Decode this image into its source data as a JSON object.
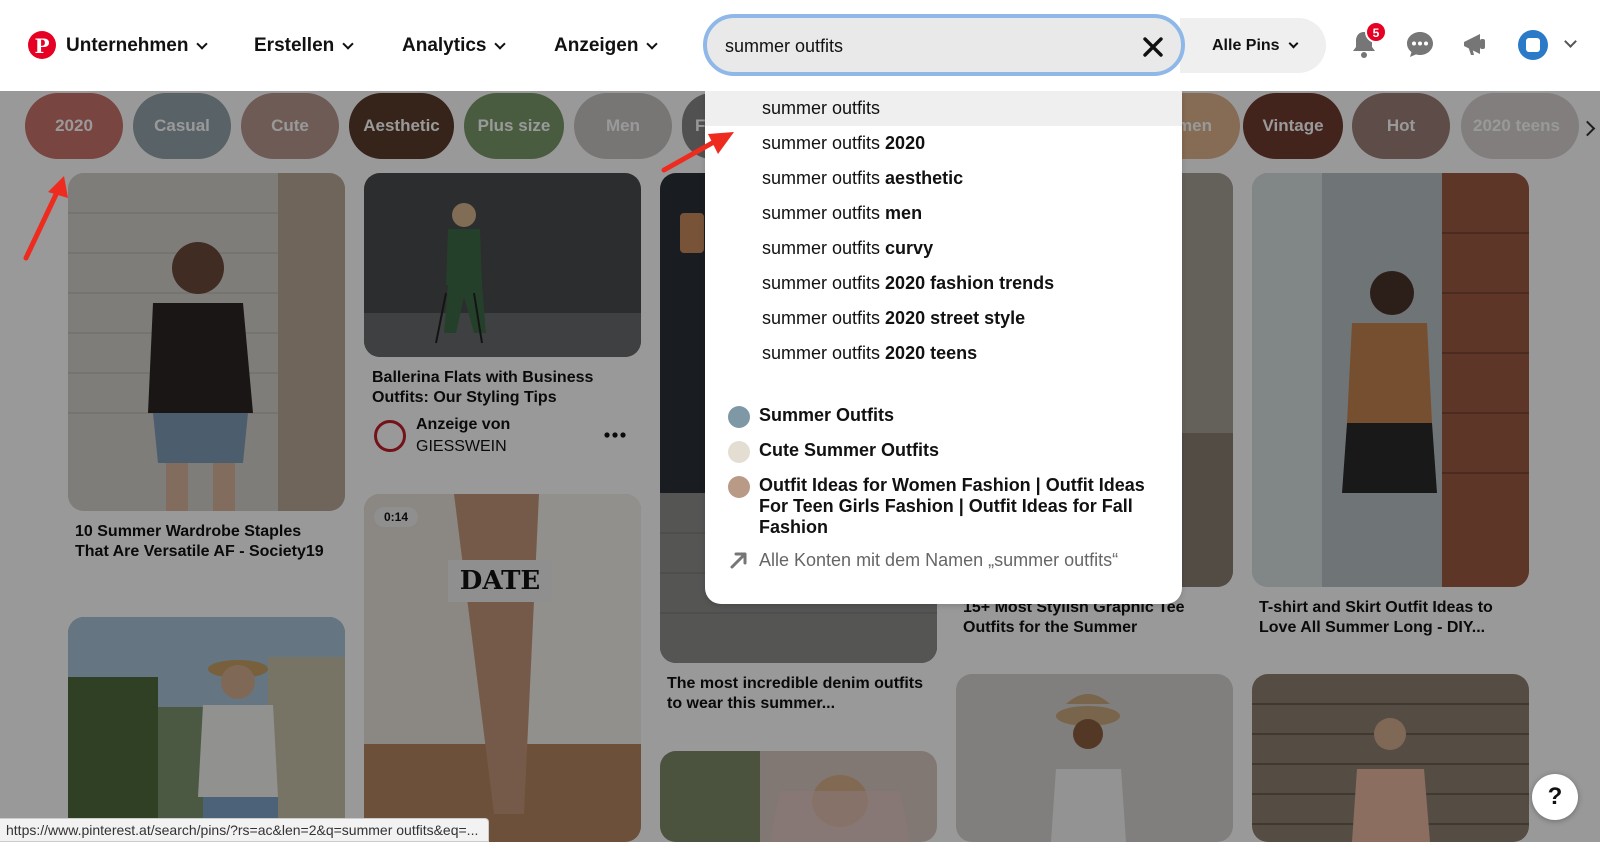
{
  "header": {
    "logo_letter": "P",
    "nav": [
      "Unternehmen",
      "Erstellen",
      "Analytics",
      "Anzeigen"
    ],
    "search_value": "summer outfits",
    "scope_label": "Alle Pins",
    "notification_count": "5"
  },
  "chips": [
    {
      "label": "2020",
      "color": "#c9746b"
    },
    {
      "label": "Casual",
      "color": "#95a3ab"
    },
    {
      "label": "Cute",
      "color": "#b8988f"
    },
    {
      "label": "Aesthetic",
      "color": "#5a3b2b"
    },
    {
      "label": "Plus size",
      "color": "#7c9a6c"
    },
    {
      "label": "Men",
      "color": "#c8c5c4"
    },
    {
      "label": "F",
      "color": "#888888"
    },
    {
      "label": "men",
      "color": "#e0b58c"
    },
    {
      "label": "Vintage",
      "color": "#6e3c30"
    },
    {
      "label": "Hot",
      "color": "#9c7f77"
    },
    {
      "label": "2020 teens",
      "color": "#d7d2d0"
    }
  ],
  "pins": [
    {
      "title": "10 Summer Wardrobe Staples That Are Versatile AF - Society19"
    },
    {
      "title": "Ballerina Flats with Business Outfits: Our Styling Tips",
      "promoted_label": "Anzeige von",
      "promoter": "GIESSWEIN"
    },
    {
      "title": "The most incredible denim outfits to wear this summer..."
    },
    {
      "title": "15+ Most Stylish Graphic Tee Outfits for the Summer"
    },
    {
      "title": "T-shirt and Skirt Outfit Ideas to Love All Summer Long - DIY..."
    },
    {
      "video_duration": "0:14",
      "sign_text": "DATE"
    }
  ],
  "dropdown": {
    "suggestions": [
      {
        "base": "summer outfits",
        "bold": ""
      },
      {
        "base": "summer outfits",
        "bold": "2020"
      },
      {
        "base": "summer outfits",
        "bold": "aesthetic"
      },
      {
        "base": "summer outfits",
        "bold": "men"
      },
      {
        "base": "summer outfits",
        "bold": "curvy"
      },
      {
        "base": "summer outfits",
        "bold": "2020 fashion trends"
      },
      {
        "base": "summer outfits",
        "bold": "2020 street style"
      },
      {
        "base": "summer outfits",
        "bold": "2020 teens"
      }
    ],
    "boards": [
      "Summer Outfits",
      "Cute Summer Outfits",
      "Outfit Ideas for Women Fashion | Outfit Ideas For Teen Girls Fashion | Outfit Ideas for Fall Fashion"
    ],
    "accounts_label": "Alle Konten mit dem Namen „summer outfits“"
  },
  "help_label": "?",
  "status_url": "https://www.pinterest.at/search/pins/?rs=ac&len=2&q=summer outfits&eq=..."
}
